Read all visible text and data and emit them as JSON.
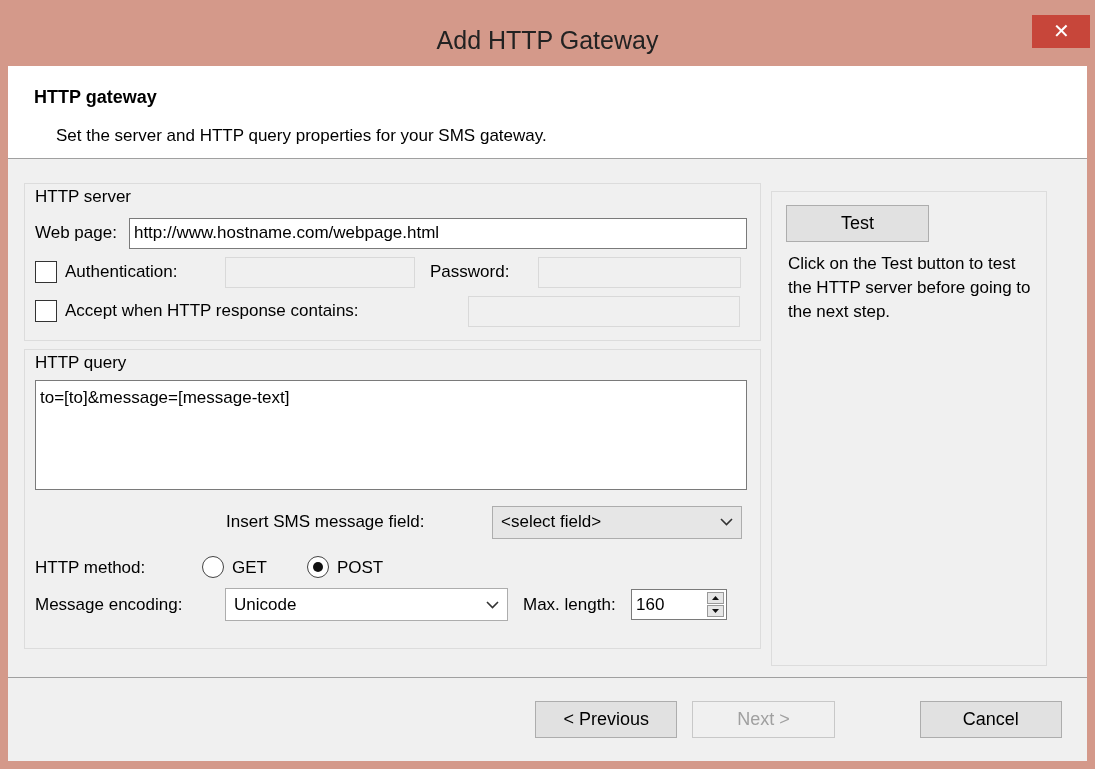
{
  "window": {
    "title": "Add HTTP Gateway",
    "close": "✕"
  },
  "header": {
    "title": "HTTP gateway",
    "description": "Set the server and HTTP query properties for your SMS gateway."
  },
  "http_server": {
    "legend": "HTTP server",
    "web_page_label": "Web page:",
    "web_page_value": "http://www.hostname.com/webpage.html",
    "authentication": {
      "label": "Authentication:",
      "checked": false
    },
    "password_label": "Password:",
    "accept": {
      "label": "Accept when HTTP response contains:",
      "checked": false
    }
  },
  "http_query": {
    "legend": "HTTP query",
    "query": "to=[to]&message=[message-text]",
    "insert_label": "Insert SMS message field:",
    "insert_value": "<select field>",
    "method_label": "HTTP method:",
    "methods": [
      {
        "label": "GET",
        "selected": false
      },
      {
        "label": "POST",
        "selected": true
      }
    ],
    "encoding_label": "Message encoding:",
    "encoding_value": "Unicode",
    "max_length_label": "Max. length:",
    "max_length_value": "160"
  },
  "test_panel": {
    "button": "Test",
    "help": "Click on the Test button to test the HTTP server before going to the next step."
  },
  "buttons": [
    {
      "label": "< Previous",
      "disabled": false
    },
    {
      "label": "Next >",
      "disabled": true
    },
    {
      "label": "Cancel",
      "disabled": false
    }
  ]
}
